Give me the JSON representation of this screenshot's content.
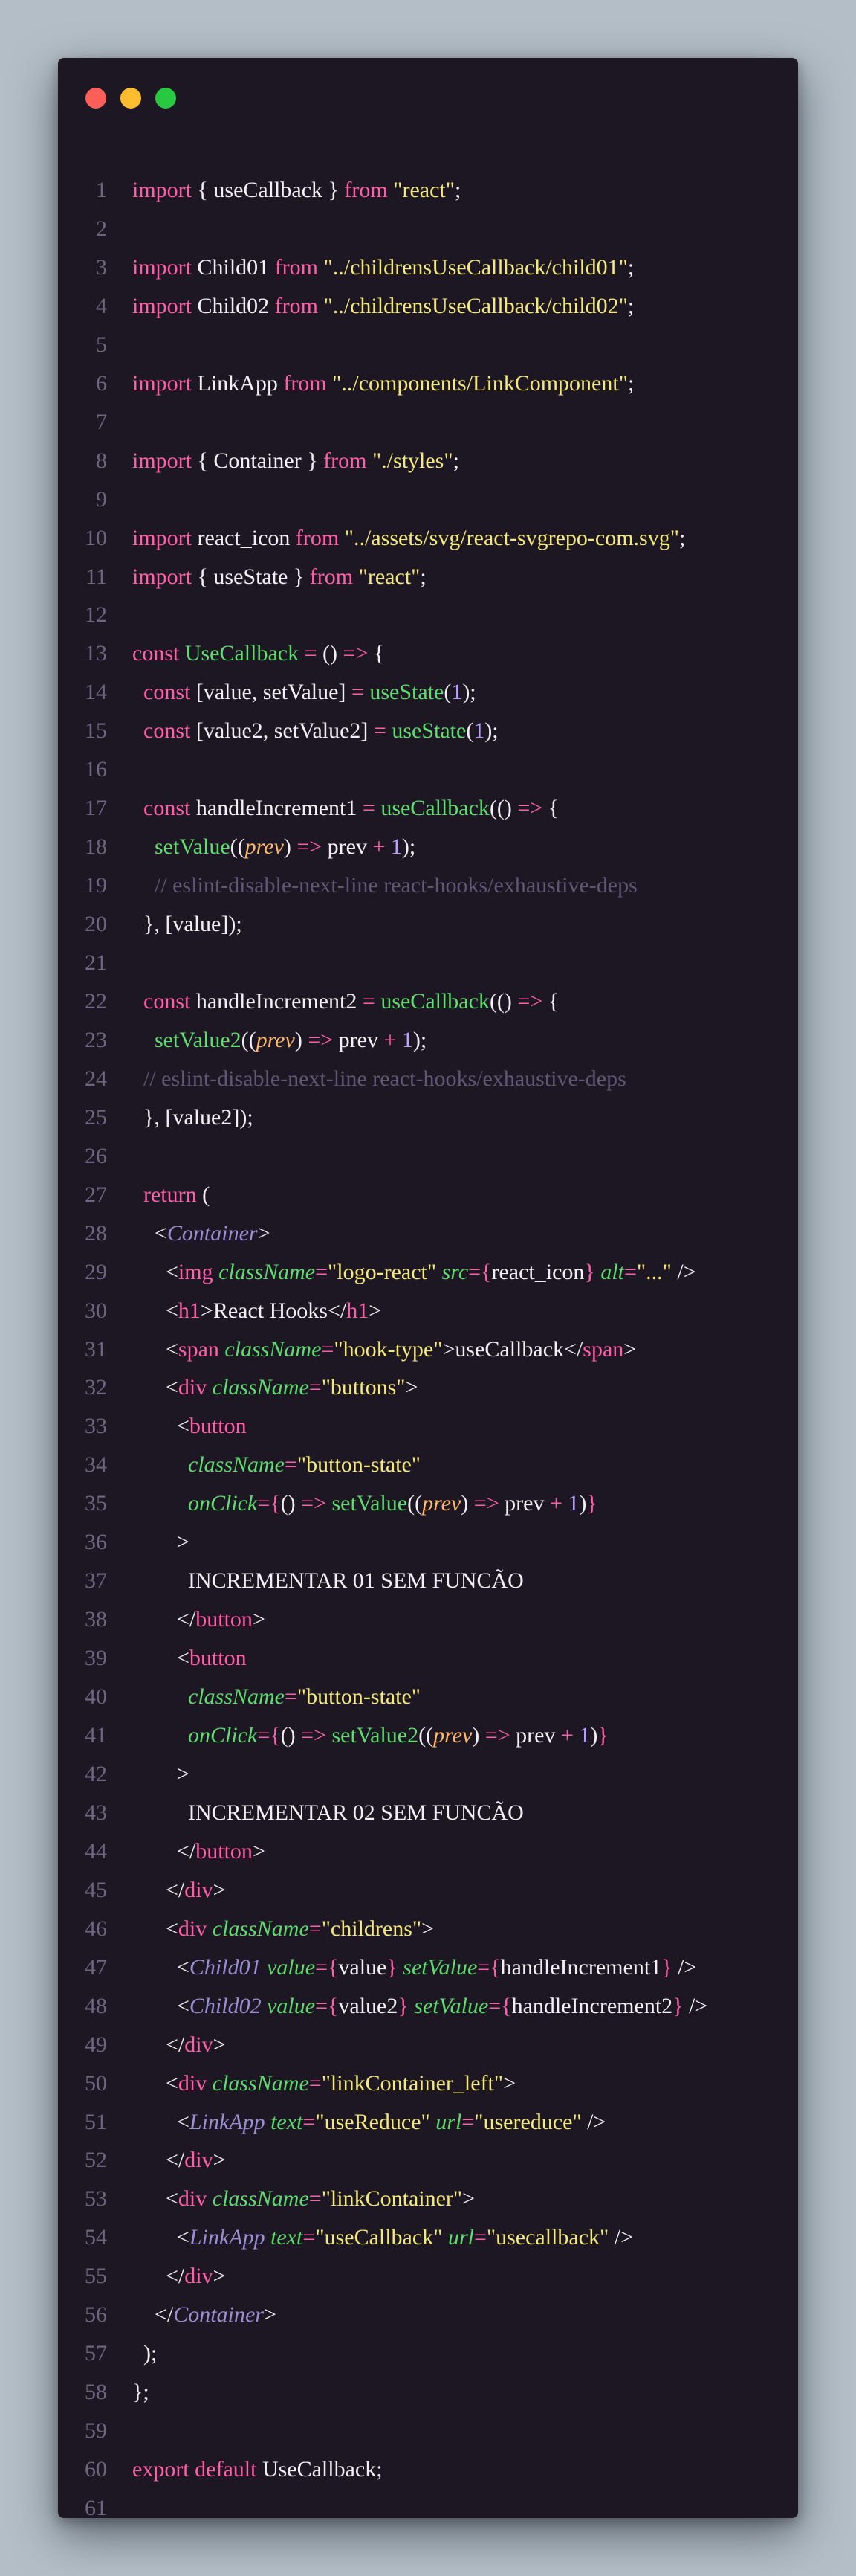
{
  "window": {
    "controls": [
      {
        "name": "close",
        "color": "#ff5f57"
      },
      {
        "name": "minimize",
        "color": "#febc2e"
      },
      {
        "name": "maximize",
        "color": "#28c840"
      }
    ]
  },
  "code": {
    "lines": [
      [
        [
          "kw",
          "import"
        ],
        [
          "pl",
          " { useCallback } "
        ],
        [
          "kw",
          "from"
        ],
        [
          "pl",
          " "
        ],
        [
          "str",
          "\"react\""
        ],
        [
          "pl",
          ";"
        ]
      ],
      [],
      [
        [
          "kw",
          "import"
        ],
        [
          "pl",
          " Child01 "
        ],
        [
          "kw",
          "from"
        ],
        [
          "pl",
          " "
        ],
        [
          "str",
          "\"../childrensUseCallback/child01\""
        ],
        [
          "pl",
          ";"
        ]
      ],
      [
        [
          "kw",
          "import"
        ],
        [
          "pl",
          " Child02 "
        ],
        [
          "kw",
          "from"
        ],
        [
          "pl",
          " "
        ],
        [
          "str",
          "\"../childrensUseCallback/child02\""
        ],
        [
          "pl",
          ";"
        ]
      ],
      [],
      [
        [
          "kw",
          "import"
        ],
        [
          "pl",
          " LinkApp "
        ],
        [
          "kw",
          "from"
        ],
        [
          "pl",
          " "
        ],
        [
          "str",
          "\"../components/LinkComponent\""
        ],
        [
          "pl",
          ";"
        ]
      ],
      [],
      [
        [
          "kw",
          "import"
        ],
        [
          "pl",
          " { Container } "
        ],
        [
          "kw",
          "from"
        ],
        [
          "pl",
          " "
        ],
        [
          "str",
          "\"./styles\""
        ],
        [
          "pl",
          ";"
        ]
      ],
      [],
      [
        [
          "kw",
          "import"
        ],
        [
          "pl",
          " react_icon "
        ],
        [
          "kw",
          "from"
        ],
        [
          "pl",
          " "
        ],
        [
          "str",
          "\"../assets/svg/react-svgrepo-com.svg\""
        ],
        [
          "pl",
          ";"
        ]
      ],
      [
        [
          "kw",
          "import"
        ],
        [
          "pl",
          " { useState } "
        ],
        [
          "kw",
          "from"
        ],
        [
          "pl",
          " "
        ],
        [
          "str",
          "\"react\""
        ],
        [
          "pl",
          ";"
        ]
      ],
      [],
      [
        [
          "kw",
          "const"
        ],
        [
          "pl",
          " "
        ],
        [
          "fn",
          "UseCallback"
        ],
        [
          "pl",
          " "
        ],
        [
          "op",
          "="
        ],
        [
          "pl",
          " () "
        ],
        [
          "op",
          "=>"
        ],
        [
          "pl",
          " {"
        ]
      ],
      [
        [
          "pl",
          "  "
        ],
        [
          "kw",
          "const"
        ],
        [
          "pl",
          " [value, setValue] "
        ],
        [
          "op",
          "="
        ],
        [
          "pl",
          " "
        ],
        [
          "fn",
          "useState"
        ],
        [
          "pl",
          "("
        ],
        [
          "num",
          "1"
        ],
        [
          "pl",
          ");"
        ]
      ],
      [
        [
          "pl",
          "  "
        ],
        [
          "kw",
          "const"
        ],
        [
          "pl",
          " [value2, setValue2] "
        ],
        [
          "op",
          "="
        ],
        [
          "pl",
          " "
        ],
        [
          "fn",
          "useState"
        ],
        [
          "pl",
          "("
        ],
        [
          "num",
          "1"
        ],
        [
          "pl",
          ");"
        ]
      ],
      [],
      [
        [
          "pl",
          "  "
        ],
        [
          "kw",
          "const"
        ],
        [
          "pl",
          " handleIncrement1 "
        ],
        [
          "op",
          "="
        ],
        [
          "pl",
          " "
        ],
        [
          "fn",
          "useCallback"
        ],
        [
          "pl",
          "(() "
        ],
        [
          "op",
          "=>"
        ],
        [
          "pl",
          " {"
        ]
      ],
      [
        [
          "pl",
          "    "
        ],
        [
          "fn",
          "setValue"
        ],
        [
          "pl",
          "(("
        ],
        [
          "param",
          "prev"
        ],
        [
          "pl",
          ") "
        ],
        [
          "op",
          "=>"
        ],
        [
          "pl",
          " prev "
        ],
        [
          "op",
          "+"
        ],
        [
          "pl",
          " "
        ],
        [
          "num",
          "1"
        ],
        [
          "pl",
          ");"
        ]
      ],
      [
        [
          "pl",
          "    "
        ],
        [
          "cm",
          "// eslint-disable-next-line react-hooks/exhaustive-deps"
        ]
      ],
      [
        [
          "pl",
          "  }, [value]);"
        ]
      ],
      [],
      [
        [
          "pl",
          "  "
        ],
        [
          "kw",
          "const"
        ],
        [
          "pl",
          " handleIncrement2 "
        ],
        [
          "op",
          "="
        ],
        [
          "pl",
          " "
        ],
        [
          "fn",
          "useCallback"
        ],
        [
          "pl",
          "(() "
        ],
        [
          "op",
          "=>"
        ],
        [
          "pl",
          " {"
        ]
      ],
      [
        [
          "pl",
          "    "
        ],
        [
          "fn",
          "setValue2"
        ],
        [
          "pl",
          "(("
        ],
        [
          "param",
          "prev"
        ],
        [
          "pl",
          ") "
        ],
        [
          "op",
          "=>"
        ],
        [
          "pl",
          " prev "
        ],
        [
          "op",
          "+"
        ],
        [
          "pl",
          " "
        ],
        [
          "num",
          "1"
        ],
        [
          "pl",
          ");"
        ]
      ],
      [
        [
          "pl",
          "  "
        ],
        [
          "cm",
          "// eslint-disable-next-line react-hooks/exhaustive-deps"
        ]
      ],
      [
        [
          "pl",
          "  }, [value2]);"
        ]
      ],
      [],
      [
        [
          "pl",
          "  "
        ],
        [
          "kw",
          "return"
        ],
        [
          "pl",
          " ("
        ]
      ],
      [
        [
          "pl",
          "    <"
        ],
        [
          "comp",
          "Container"
        ],
        [
          "pl",
          ">"
        ]
      ],
      [
        [
          "pl",
          "      <"
        ],
        [
          "tag",
          "img"
        ],
        [
          "pl",
          " "
        ],
        [
          "attr",
          "className"
        ],
        [
          "op",
          "="
        ],
        [
          "str",
          "\"logo-react\""
        ],
        [
          "pl",
          " "
        ],
        [
          "attr",
          "src"
        ],
        [
          "op",
          "={"
        ],
        [
          "pl",
          "react_icon"
        ],
        [
          "op",
          "}"
        ],
        [
          "pl",
          " "
        ],
        [
          "attr",
          "alt"
        ],
        [
          "op",
          "="
        ],
        [
          "str",
          "\"...\""
        ],
        [
          "pl",
          " />"
        ]
      ],
      [
        [
          "pl",
          "      <"
        ],
        [
          "tag",
          "h1"
        ],
        [
          "pl",
          ">React Hooks</"
        ],
        [
          "tag",
          "h1"
        ],
        [
          "pl",
          ">"
        ]
      ],
      [
        [
          "pl",
          "      <"
        ],
        [
          "tag",
          "span"
        ],
        [
          "pl",
          " "
        ],
        [
          "attr",
          "className"
        ],
        [
          "op",
          "="
        ],
        [
          "str",
          "\"hook-type\""
        ],
        [
          "pl",
          ">useCallback</"
        ],
        [
          "tag",
          "span"
        ],
        [
          "pl",
          ">"
        ]
      ],
      [
        [
          "pl",
          "      <"
        ],
        [
          "tag",
          "div"
        ],
        [
          "pl",
          " "
        ],
        [
          "attr",
          "className"
        ],
        [
          "op",
          "="
        ],
        [
          "str",
          "\"buttons\""
        ],
        [
          "pl",
          ">"
        ]
      ],
      [
        [
          "pl",
          "        <"
        ],
        [
          "tag",
          "button"
        ]
      ],
      [
        [
          "pl",
          "          "
        ],
        [
          "attr",
          "className"
        ],
        [
          "op",
          "="
        ],
        [
          "str",
          "\"button-state\""
        ]
      ],
      [
        [
          "pl",
          "          "
        ],
        [
          "attr",
          "onClick"
        ],
        [
          "op",
          "={"
        ],
        [
          "pl",
          "() "
        ],
        [
          "op",
          "=>"
        ],
        [
          "pl",
          " "
        ],
        [
          "fn",
          "setValue"
        ],
        [
          "pl",
          "(("
        ],
        [
          "param",
          "prev"
        ],
        [
          "pl",
          ") "
        ],
        [
          "op",
          "=>"
        ],
        [
          "pl",
          " prev "
        ],
        [
          "op",
          "+"
        ],
        [
          "pl",
          " "
        ],
        [
          "num",
          "1"
        ],
        [
          "pl",
          ")"
        ],
        [
          "op",
          "}"
        ]
      ],
      [
        [
          "pl",
          "        >"
        ]
      ],
      [
        [
          "pl",
          "          INCREMENTAR 01 SEM FUNCÃO"
        ]
      ],
      [
        [
          "pl",
          "        </"
        ],
        [
          "tag",
          "button"
        ],
        [
          "pl",
          ">"
        ]
      ],
      [
        [
          "pl",
          "        <"
        ],
        [
          "tag",
          "button"
        ]
      ],
      [
        [
          "pl",
          "          "
        ],
        [
          "attr",
          "className"
        ],
        [
          "op",
          "="
        ],
        [
          "str",
          "\"button-state\""
        ]
      ],
      [
        [
          "pl",
          "          "
        ],
        [
          "attr",
          "onClick"
        ],
        [
          "op",
          "={"
        ],
        [
          "pl",
          "() "
        ],
        [
          "op",
          "=>"
        ],
        [
          "pl",
          " "
        ],
        [
          "fn",
          "setValue2"
        ],
        [
          "pl",
          "(("
        ],
        [
          "param",
          "prev"
        ],
        [
          "pl",
          ") "
        ],
        [
          "op",
          "=>"
        ],
        [
          "pl",
          " prev "
        ],
        [
          "op",
          "+"
        ],
        [
          "pl",
          " "
        ],
        [
          "num",
          "1"
        ],
        [
          "pl",
          ")"
        ],
        [
          "op",
          "}"
        ]
      ],
      [
        [
          "pl",
          "        >"
        ]
      ],
      [
        [
          "pl",
          "          INCREMENTAR 02 SEM FUNCÃO"
        ]
      ],
      [
        [
          "pl",
          "        </"
        ],
        [
          "tag",
          "button"
        ],
        [
          "pl",
          ">"
        ]
      ],
      [
        [
          "pl",
          "      </"
        ],
        [
          "tag",
          "div"
        ],
        [
          "pl",
          ">"
        ]
      ],
      [
        [
          "pl",
          "      <"
        ],
        [
          "tag",
          "div"
        ],
        [
          "pl",
          " "
        ],
        [
          "attr",
          "className"
        ],
        [
          "op",
          "="
        ],
        [
          "str",
          "\"childrens\""
        ],
        [
          "pl",
          ">"
        ]
      ],
      [
        [
          "pl",
          "        <"
        ],
        [
          "comp",
          "Child01"
        ],
        [
          "pl",
          " "
        ],
        [
          "attr",
          "value"
        ],
        [
          "op",
          "={"
        ],
        [
          "pl",
          "value"
        ],
        [
          "op",
          "}"
        ],
        [
          "pl",
          " "
        ],
        [
          "attr",
          "setValue"
        ],
        [
          "op",
          "={"
        ],
        [
          "pl",
          "handleIncrement1"
        ],
        [
          "op",
          "}"
        ],
        [
          "pl",
          " />"
        ]
      ],
      [
        [
          "pl",
          "        <"
        ],
        [
          "comp",
          "Child02"
        ],
        [
          "pl",
          " "
        ],
        [
          "attr",
          "value"
        ],
        [
          "op",
          "={"
        ],
        [
          "pl",
          "value2"
        ],
        [
          "op",
          "}"
        ],
        [
          "pl",
          " "
        ],
        [
          "attr",
          "setValue"
        ],
        [
          "op",
          "={"
        ],
        [
          "pl",
          "handleIncrement2"
        ],
        [
          "op",
          "}"
        ],
        [
          "pl",
          " />"
        ]
      ],
      [
        [
          "pl",
          "      </"
        ],
        [
          "tag",
          "div"
        ],
        [
          "pl",
          ">"
        ]
      ],
      [
        [
          "pl",
          "      <"
        ],
        [
          "tag",
          "div"
        ],
        [
          "pl",
          " "
        ],
        [
          "attr",
          "className"
        ],
        [
          "op",
          "="
        ],
        [
          "str",
          "\"linkContainer_left\""
        ],
        [
          "pl",
          ">"
        ]
      ],
      [
        [
          "pl",
          "        <"
        ],
        [
          "comp",
          "LinkApp"
        ],
        [
          "pl",
          " "
        ],
        [
          "attr",
          "text"
        ],
        [
          "op",
          "="
        ],
        [
          "str",
          "\"useReduce\""
        ],
        [
          "pl",
          " "
        ],
        [
          "attr",
          "url"
        ],
        [
          "op",
          "="
        ],
        [
          "str",
          "\"usereduce\""
        ],
        [
          "pl",
          " />"
        ]
      ],
      [
        [
          "pl",
          "      </"
        ],
        [
          "tag",
          "div"
        ],
        [
          "pl",
          ">"
        ]
      ],
      [
        [
          "pl",
          "      <"
        ],
        [
          "tag",
          "div"
        ],
        [
          "pl",
          " "
        ],
        [
          "attr",
          "className"
        ],
        [
          "op",
          "="
        ],
        [
          "str",
          "\"linkContainer\""
        ],
        [
          "pl",
          ">"
        ]
      ],
      [
        [
          "pl",
          "        <"
        ],
        [
          "comp",
          "LinkApp"
        ],
        [
          "pl",
          " "
        ],
        [
          "attr",
          "text"
        ],
        [
          "op",
          "="
        ],
        [
          "str",
          "\"useCallback\""
        ],
        [
          "pl",
          " "
        ],
        [
          "attr",
          "url"
        ],
        [
          "op",
          "="
        ],
        [
          "str",
          "\"usecallback\""
        ],
        [
          "pl",
          " />"
        ]
      ],
      [
        [
          "pl",
          "      </"
        ],
        [
          "tag",
          "div"
        ],
        [
          "pl",
          ">"
        ]
      ],
      [
        [
          "pl",
          "    </"
        ],
        [
          "comp",
          "Container"
        ],
        [
          "pl",
          ">"
        ]
      ],
      [
        [
          "pl",
          "  );"
        ]
      ],
      [
        [
          "pl",
          "};"
        ]
      ],
      [],
      [
        [
          "kw",
          "export"
        ],
        [
          "pl",
          " "
        ],
        [
          "kw",
          "default"
        ],
        [
          "pl",
          " UseCallback;"
        ]
      ],
      []
    ]
  }
}
